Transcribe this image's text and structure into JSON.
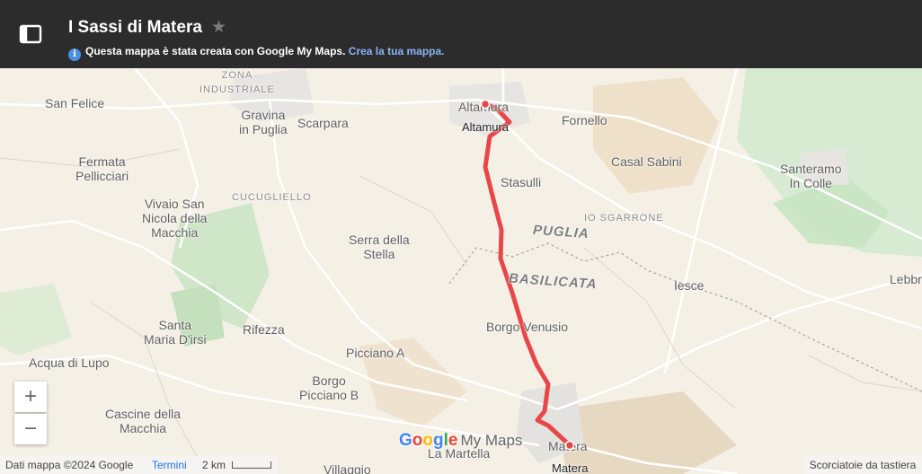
{
  "header": {
    "title": "I Sassi di Matera",
    "star_icon": "star-icon",
    "subtitle": "Questa mappa è stata creata con Google My Maps.",
    "create_link": "Crea la tua mappa.",
    "info_icon": "i"
  },
  "map": {
    "labels": {
      "zona_industriale": "ZONA\nINDUSTRIALE",
      "san_felice": "San Felice",
      "gravina": "Gravina\nin Puglia",
      "scarpara": "Scarpara",
      "altamura_map": "Altamura",
      "altamura_pin": "Altamura",
      "fornello": "Fornello",
      "fermata_pellicciari": "Fermata\nPellicciari",
      "casal_sabini": "Casal Sabini",
      "santeramo": "Santeramo\nIn Colle",
      "cucugliello": "CUCUGLIELLO",
      "stasulli": "Stasulli",
      "vivaio": "Vivaio San\nNicola della\nMacchia",
      "io_sgarrone": "IO SGARRONE",
      "puglia": "PUGLIA",
      "serra_stella": "Serra della\nStella",
      "basilicata": "BASILICATA",
      "iesce": "Iesce",
      "lebbri": "Lebbri",
      "rifezza": "Rifezza",
      "santa_maria": "Santa\nMaria D'irsi",
      "borgo_venusio": "Borgo Venusio",
      "picciano_a": "Picciano A",
      "acqua_di_lupo": "Acqua di Lupo",
      "borgo_picciano": "Borgo\nPicciano B",
      "cascine": "Cascine della\nMacchia",
      "la_martella": "La Martella",
      "villaggio": "Villaggio",
      "matera_map": "Matera",
      "matera_pin": "Matera"
    },
    "route_color": "#e8474a",
    "pin_color": "#e8474a"
  },
  "controls": {
    "zoom_in": "+",
    "zoom_out": "−"
  },
  "footer": {
    "map_data": "Dati mappa ©2024 Google",
    "terms": "Termini",
    "scale": "2 km",
    "shortcuts": "Scorciatoie da tastiera",
    "brand_google": "Google",
    "brand_mymaps": "My Maps"
  }
}
